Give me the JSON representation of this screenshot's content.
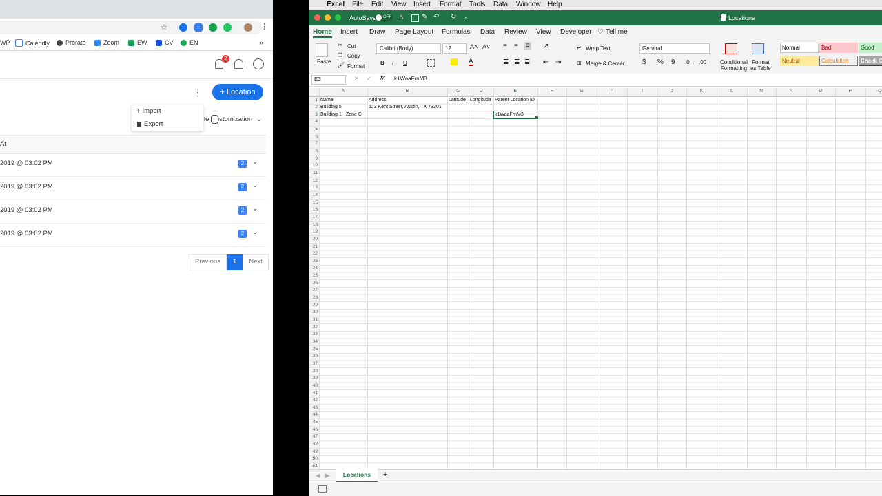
{
  "browser": {
    "bookmarks": [
      "WP",
      "Calendly",
      "Prorate",
      "Zoom",
      "EW",
      "CV",
      "EN"
    ],
    "bookmark_colors": [
      "#888888",
      "#3b82f6",
      "#444444",
      "#2d8cff",
      "#0f9d58",
      "#1d4ed8",
      "#16a34a"
    ],
    "more_bookmarks": "»",
    "notification_count": "2",
    "add_location_label": "+ Location",
    "dropdown": {
      "import_label": "Import",
      "export_label": "Export"
    },
    "customization_label": "le Customization",
    "table": {
      "header": "At",
      "rows": [
        {
          "date": "2019 @ 03:02 PM",
          "count": "2"
        },
        {
          "date": "2019 @ 03:02 PM",
          "count": "2"
        },
        {
          "date": "2019 @ 03:02 PM",
          "count": "2"
        },
        {
          "date": "2019 @ 03:02 PM",
          "count": "2"
        }
      ]
    },
    "pagination": {
      "previous": "Previous",
      "page": "1",
      "next": "Next"
    }
  },
  "menubar": {
    "app": "Excel",
    "items": [
      "File",
      "Edit",
      "View",
      "Insert",
      "Format",
      "Tools",
      "Data",
      "Window",
      "Help"
    ]
  },
  "excel": {
    "autosave_label": "AutoSave",
    "autosave_state": "OFF",
    "doc_title": "Locations",
    "tabs": [
      "Home",
      "Insert",
      "Draw",
      "Page Layout",
      "Formulas",
      "Data",
      "Review",
      "View",
      "Developer"
    ],
    "tell_me": "Tell me",
    "ribbon": {
      "paste": "Paste",
      "cut": "Cut",
      "copy": "Copy",
      "format": "Format",
      "font_name": "Calibri (Body)",
      "font_size": "12",
      "bold": "B",
      "italic": "I",
      "underline": "U",
      "wrap_text": "Wrap Text",
      "merge_center": "Merge & Center",
      "number_format": "General",
      "conditional_formatting_1": "Conditional",
      "conditional_formatting_2": "Formatting",
      "format_as_table_1": "Format",
      "format_as_table_2": "as Table",
      "styles": [
        {
          "label": "Normal",
          "bg": "#ffffff",
          "fg": "#000000"
        },
        {
          "label": "Bad",
          "bg": "#ffc7ce",
          "fg": "#9c0006"
        },
        {
          "label": "Good",
          "bg": "#c6efce",
          "fg": "#006100"
        },
        {
          "label": "Neutral",
          "bg": "#ffeb9c",
          "fg": "#9c5700"
        },
        {
          "label": "Calculation",
          "bg": "#f2f2f2",
          "fg": "#fa7d00"
        },
        {
          "label": "Check Ce",
          "bg": "#a5a5a5",
          "fg": "#ffffff"
        }
      ]
    },
    "name_box": "E3",
    "fx": "fx",
    "formula_value": "k1WaaFrnM3",
    "columns": [
      "A",
      "B",
      "C",
      "D",
      "E",
      "F",
      "G",
      "H",
      "I",
      "J",
      "K",
      "L",
      "M",
      "N",
      "O",
      "P",
      "Q"
    ],
    "row_count": 51,
    "cells": [
      {
        "row": 1,
        "col": 0,
        "text": "Name"
      },
      {
        "row": 1,
        "col": 1,
        "text": "Address"
      },
      {
        "row": 1,
        "col": 2,
        "text": "Latitude"
      },
      {
        "row": 1,
        "col": 3,
        "text": "Longitude"
      },
      {
        "row": 1,
        "col": 4,
        "text": "Parent Location ID"
      },
      {
        "row": 2,
        "col": 0,
        "text": "Building 5"
      },
      {
        "row": 2,
        "col": 1,
        "text": "123 Kent Street, Austin, TX 73301"
      },
      {
        "row": 3,
        "col": 0,
        "text": "Building 1 - Zone C"
      },
      {
        "row": 3,
        "col": 4,
        "text": "k1WaaFrnM3"
      }
    ],
    "selected": {
      "row": 3,
      "col": 4
    },
    "sheet_tab": "Locations",
    "add_sheet": "+"
  }
}
